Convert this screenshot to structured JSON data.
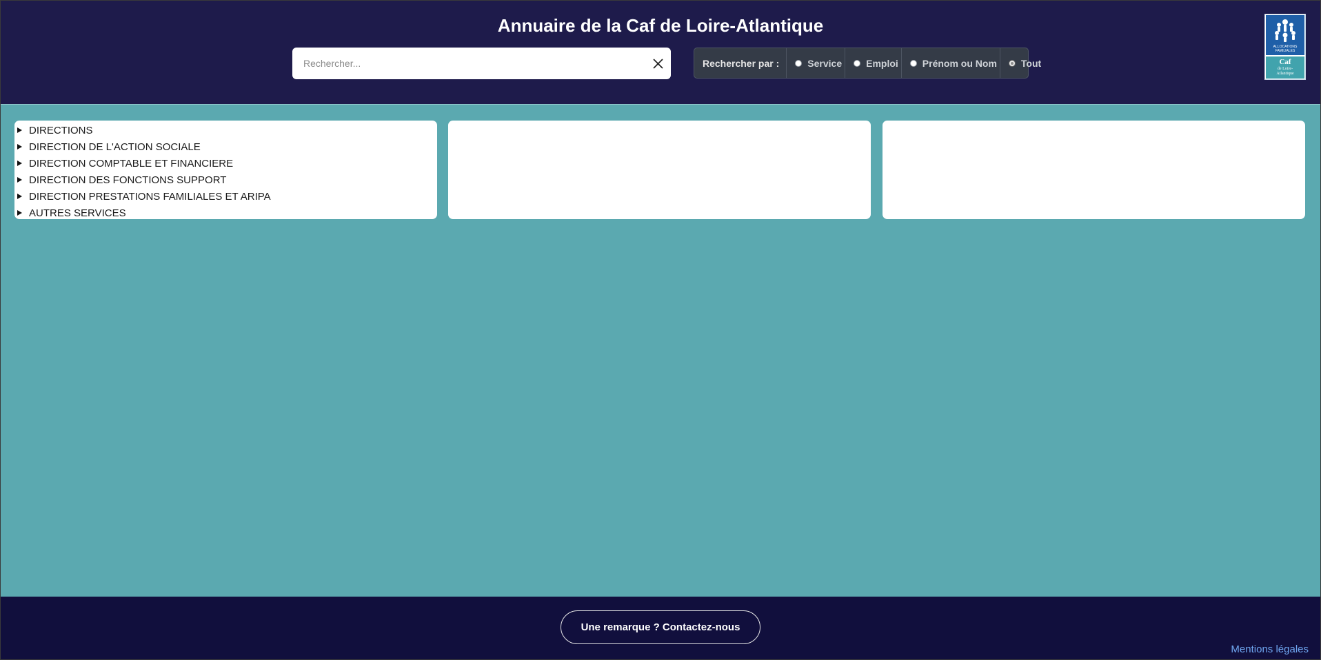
{
  "header": {
    "title": "Annuaire de la Caf de Loire-Atlantique",
    "search": {
      "placeholder": "Rechercher...",
      "value": ""
    },
    "filter": {
      "label": "Rechercher par :",
      "options": [
        {
          "label": "Service",
          "checked": false
        },
        {
          "label": "Emploi",
          "checked": false
        },
        {
          "label": "Prénom ou Nom",
          "checked": false
        },
        {
          "label": "Tout",
          "checked": true
        }
      ]
    },
    "logo": {
      "line1": "ALLOCATIONS",
      "line2": "FAMILIALES",
      "caf": "Caf",
      "sub1": "de Loire-",
      "sub2": "Atlantique"
    }
  },
  "tree": {
    "items": [
      "DIRECTIONS",
      "DIRECTION DE L'ACTION SOCIALE",
      "DIRECTION COMPTABLE ET FINANCIERE",
      "DIRECTION DES FONCTIONS SUPPORT",
      "DIRECTION PRESTATIONS FAMILIALES ET ARIPA",
      "AUTRES SERVICES"
    ]
  },
  "footer": {
    "contact_label": "Une remarque ? Contactez-nous",
    "legal_label": "Mentions légales"
  },
  "colors": {
    "header_bg": "#1e1b4b",
    "main_bg": "#5ba9b0",
    "footer_bg": "#110f3d",
    "link": "#6fa6f0"
  }
}
